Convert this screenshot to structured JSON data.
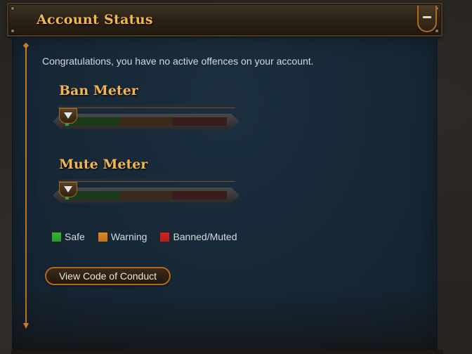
{
  "header": {
    "title": "Account Status",
    "collapse_icon": "minus-icon"
  },
  "intro_text": "Congratulations, you have no active offences on your account.",
  "meters": [
    {
      "title": "Ban Meter",
      "level": 0.02,
      "pointer_icon": "triangle-down-icon"
    },
    {
      "title": "Mute Meter",
      "level": 0.02,
      "pointer_icon": "triangle-down-icon"
    }
  ],
  "legend": [
    {
      "label": "Safe",
      "color": "#2fb52f"
    },
    {
      "label": "Warning",
      "color": "#e0891f"
    },
    {
      "label": "Banned/Muted",
      "color": "#d42020"
    }
  ],
  "cta_label": "View Code of Conduct",
  "colors": {
    "accent": "#f2b552",
    "panel": "#172a39",
    "frame": "#b06a1c"
  }
}
